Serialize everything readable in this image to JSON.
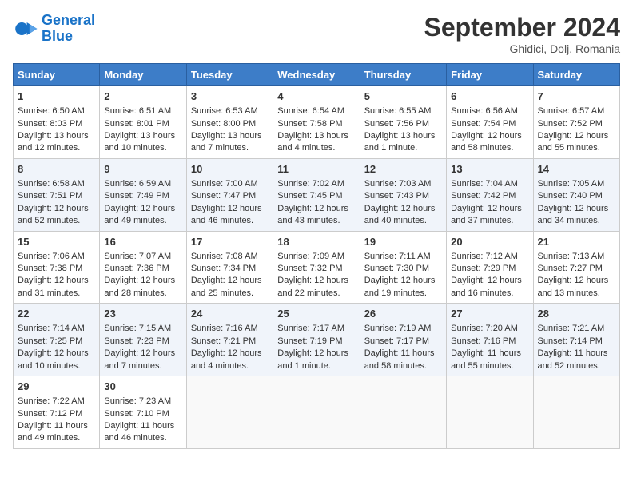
{
  "header": {
    "logo_line1": "General",
    "logo_line2": "Blue",
    "month": "September 2024",
    "location": "Ghidici, Dolj, Romania"
  },
  "days_of_week": [
    "Sunday",
    "Monday",
    "Tuesday",
    "Wednesday",
    "Thursday",
    "Friday",
    "Saturday"
  ],
  "weeks": [
    [
      {
        "day": "1",
        "lines": [
          "Sunrise: 6:50 AM",
          "Sunset: 8:03 PM",
          "Daylight: 13 hours",
          "and 12 minutes."
        ]
      },
      {
        "day": "2",
        "lines": [
          "Sunrise: 6:51 AM",
          "Sunset: 8:01 PM",
          "Daylight: 13 hours",
          "and 10 minutes."
        ]
      },
      {
        "day": "3",
        "lines": [
          "Sunrise: 6:53 AM",
          "Sunset: 8:00 PM",
          "Daylight: 13 hours",
          "and 7 minutes."
        ]
      },
      {
        "day": "4",
        "lines": [
          "Sunrise: 6:54 AM",
          "Sunset: 7:58 PM",
          "Daylight: 13 hours",
          "and 4 minutes."
        ]
      },
      {
        "day": "5",
        "lines": [
          "Sunrise: 6:55 AM",
          "Sunset: 7:56 PM",
          "Daylight: 13 hours",
          "and 1 minute."
        ]
      },
      {
        "day": "6",
        "lines": [
          "Sunrise: 6:56 AM",
          "Sunset: 7:54 PM",
          "Daylight: 12 hours",
          "and 58 minutes."
        ]
      },
      {
        "day": "7",
        "lines": [
          "Sunrise: 6:57 AM",
          "Sunset: 7:52 PM",
          "Daylight: 12 hours",
          "and 55 minutes."
        ]
      }
    ],
    [
      {
        "day": "8",
        "lines": [
          "Sunrise: 6:58 AM",
          "Sunset: 7:51 PM",
          "Daylight: 12 hours",
          "and 52 minutes."
        ]
      },
      {
        "day": "9",
        "lines": [
          "Sunrise: 6:59 AM",
          "Sunset: 7:49 PM",
          "Daylight: 12 hours",
          "and 49 minutes."
        ]
      },
      {
        "day": "10",
        "lines": [
          "Sunrise: 7:00 AM",
          "Sunset: 7:47 PM",
          "Daylight: 12 hours",
          "and 46 minutes."
        ]
      },
      {
        "day": "11",
        "lines": [
          "Sunrise: 7:02 AM",
          "Sunset: 7:45 PM",
          "Daylight: 12 hours",
          "and 43 minutes."
        ]
      },
      {
        "day": "12",
        "lines": [
          "Sunrise: 7:03 AM",
          "Sunset: 7:43 PM",
          "Daylight: 12 hours",
          "and 40 minutes."
        ]
      },
      {
        "day": "13",
        "lines": [
          "Sunrise: 7:04 AM",
          "Sunset: 7:42 PM",
          "Daylight: 12 hours",
          "and 37 minutes."
        ]
      },
      {
        "day": "14",
        "lines": [
          "Sunrise: 7:05 AM",
          "Sunset: 7:40 PM",
          "Daylight: 12 hours",
          "and 34 minutes."
        ]
      }
    ],
    [
      {
        "day": "15",
        "lines": [
          "Sunrise: 7:06 AM",
          "Sunset: 7:38 PM",
          "Daylight: 12 hours",
          "and 31 minutes."
        ]
      },
      {
        "day": "16",
        "lines": [
          "Sunrise: 7:07 AM",
          "Sunset: 7:36 PM",
          "Daylight: 12 hours",
          "and 28 minutes."
        ]
      },
      {
        "day": "17",
        "lines": [
          "Sunrise: 7:08 AM",
          "Sunset: 7:34 PM",
          "Daylight: 12 hours",
          "and 25 minutes."
        ]
      },
      {
        "day": "18",
        "lines": [
          "Sunrise: 7:09 AM",
          "Sunset: 7:32 PM",
          "Daylight: 12 hours",
          "and 22 minutes."
        ]
      },
      {
        "day": "19",
        "lines": [
          "Sunrise: 7:11 AM",
          "Sunset: 7:30 PM",
          "Daylight: 12 hours",
          "and 19 minutes."
        ]
      },
      {
        "day": "20",
        "lines": [
          "Sunrise: 7:12 AM",
          "Sunset: 7:29 PM",
          "Daylight: 12 hours",
          "and 16 minutes."
        ]
      },
      {
        "day": "21",
        "lines": [
          "Sunrise: 7:13 AM",
          "Sunset: 7:27 PM",
          "Daylight: 12 hours",
          "and 13 minutes."
        ]
      }
    ],
    [
      {
        "day": "22",
        "lines": [
          "Sunrise: 7:14 AM",
          "Sunset: 7:25 PM",
          "Daylight: 12 hours",
          "and 10 minutes."
        ]
      },
      {
        "day": "23",
        "lines": [
          "Sunrise: 7:15 AM",
          "Sunset: 7:23 PM",
          "Daylight: 12 hours",
          "and 7 minutes."
        ]
      },
      {
        "day": "24",
        "lines": [
          "Sunrise: 7:16 AM",
          "Sunset: 7:21 PM",
          "Daylight: 12 hours",
          "and 4 minutes."
        ]
      },
      {
        "day": "25",
        "lines": [
          "Sunrise: 7:17 AM",
          "Sunset: 7:19 PM",
          "Daylight: 12 hours",
          "and 1 minute."
        ]
      },
      {
        "day": "26",
        "lines": [
          "Sunrise: 7:19 AM",
          "Sunset: 7:17 PM",
          "Daylight: 11 hours",
          "and 58 minutes."
        ]
      },
      {
        "day": "27",
        "lines": [
          "Sunrise: 7:20 AM",
          "Sunset: 7:16 PM",
          "Daylight: 11 hours",
          "and 55 minutes."
        ]
      },
      {
        "day": "28",
        "lines": [
          "Sunrise: 7:21 AM",
          "Sunset: 7:14 PM",
          "Daylight: 11 hours",
          "and 52 minutes."
        ]
      }
    ],
    [
      {
        "day": "29",
        "lines": [
          "Sunrise: 7:22 AM",
          "Sunset: 7:12 PM",
          "Daylight: 11 hours",
          "and 49 minutes."
        ]
      },
      {
        "day": "30",
        "lines": [
          "Sunrise: 7:23 AM",
          "Sunset: 7:10 PM",
          "Daylight: 11 hours",
          "and 46 minutes."
        ]
      },
      {
        "day": "",
        "lines": []
      },
      {
        "day": "",
        "lines": []
      },
      {
        "day": "",
        "lines": []
      },
      {
        "day": "",
        "lines": []
      },
      {
        "day": "",
        "lines": []
      }
    ]
  ]
}
